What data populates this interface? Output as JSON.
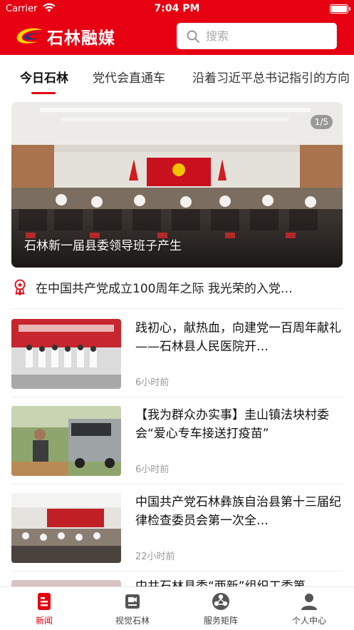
{
  "status_bar": {
    "carrier": "Carrier",
    "time": "7:04 PM"
  },
  "header": {
    "logo_text": "石林融媒",
    "search": {
      "placeholder": "搜索"
    }
  },
  "tabs": [
    {
      "label": "今日石林",
      "active": true
    },
    {
      "label": "党代会直通车",
      "active": false
    },
    {
      "label": "沿着习近平总书记指引的方向",
      "active": false
    }
  ],
  "banner": {
    "counter": "1/5",
    "caption": "石林新一届县委领导班子产生"
  },
  "notice": {
    "text": "在中国共产党成立100周年之际  我光荣的入党…",
    "icon": "award-ribbon-icon"
  },
  "news": [
    {
      "title": "践初心，献热血，向建党一百周年献礼——石林县人民医院开…",
      "time": "6小时前"
    },
    {
      "title": "【我为群众办实事】圭山镇法块村委会“爱心专车接送打疫苗”",
      "time": "6小时前"
    },
    {
      "title": "中国共产党石林彝族自治县第十三届纪律检查委员会第一次全…",
      "time": "22小时前"
    },
    {
      "title": "中共石林县委“两新”组织工委第",
      "time": ""
    }
  ],
  "bottom_nav": [
    {
      "label": "新闻",
      "active": true,
      "icon": "news-doc-icon"
    },
    {
      "label": "视觉石林",
      "active": false,
      "icon": "video-camera-icon"
    },
    {
      "label": "服务矩阵",
      "active": false,
      "icon": "service-matrix-icon"
    },
    {
      "label": "个人中心",
      "active": false,
      "icon": "user-profile-icon"
    }
  ],
  "colors": {
    "brand_red": "#e60012",
    "text_dark": "#222222",
    "muted": "#999999"
  }
}
